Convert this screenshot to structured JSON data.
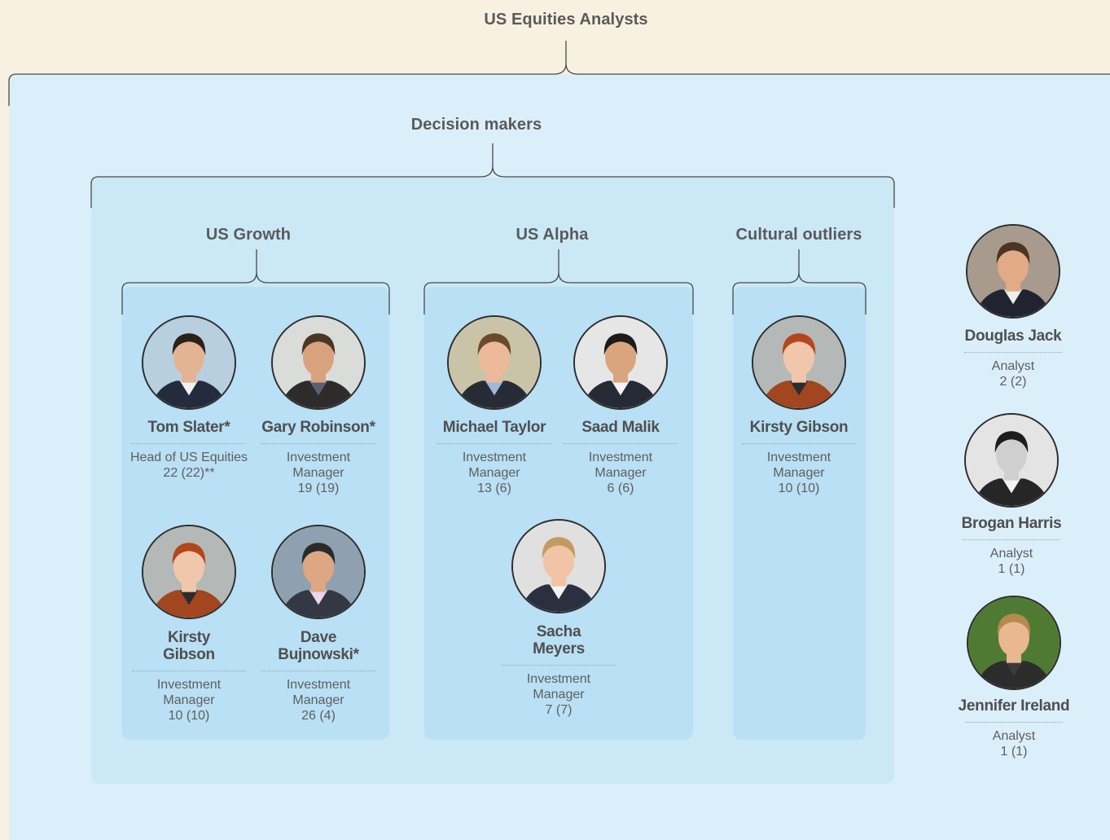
{
  "title": "US Equities Analysts",
  "decision_makers": {
    "title": "Decision makers",
    "groups": [
      {
        "title": "US Growth",
        "members": [
          {
            "name": "Tom Slater*",
            "role": "Head of US Equities",
            "count": "22 (22)**"
          },
          {
            "name": "Gary Robinson*",
            "role": "Investment Manager",
            "count": "19 (19)"
          },
          {
            "name": "Kirsty Gibson",
            "role": "Investment Manager",
            "count": "10 (10)"
          },
          {
            "name": "Dave Bujnowski*",
            "role": "Investment Manager",
            "count": "26 (4)"
          }
        ]
      },
      {
        "title": "US Alpha",
        "members": [
          {
            "name": "Michael Taylor",
            "role": "Investment Manager",
            "count": "13 (6)"
          },
          {
            "name": "Saad Malik",
            "role": "Investment Manager",
            "count": "6 (6)"
          },
          {
            "name": "Sacha Meyers",
            "role": "Investment Manager",
            "count": "7 (7)"
          }
        ]
      },
      {
        "title": "Cultural outliers",
        "members": [
          {
            "name": "Kirsty Gibson",
            "role": "Investment Manager",
            "count": "10 (10)"
          }
        ]
      }
    ]
  },
  "analysts": [
    {
      "name": "Douglas Jack",
      "role": "Analyst",
      "count": "2 (2)"
    },
    {
      "name": "Brogan Harris",
      "role": "Analyst",
      "count": "1 (1)"
    },
    {
      "name": "Jennifer Ireland",
      "role": "Analyst",
      "count": "1 (1)"
    }
  ],
  "colors": {
    "page_background": "#f8f1e1",
    "outer_panel": "#dbeffa",
    "decision_panel": "#cbe8f7",
    "group_panel": "#b9e0f4",
    "bracket_line": "#4a4a4a"
  },
  "icons": [
    "portrait-photo-icon"
  ]
}
